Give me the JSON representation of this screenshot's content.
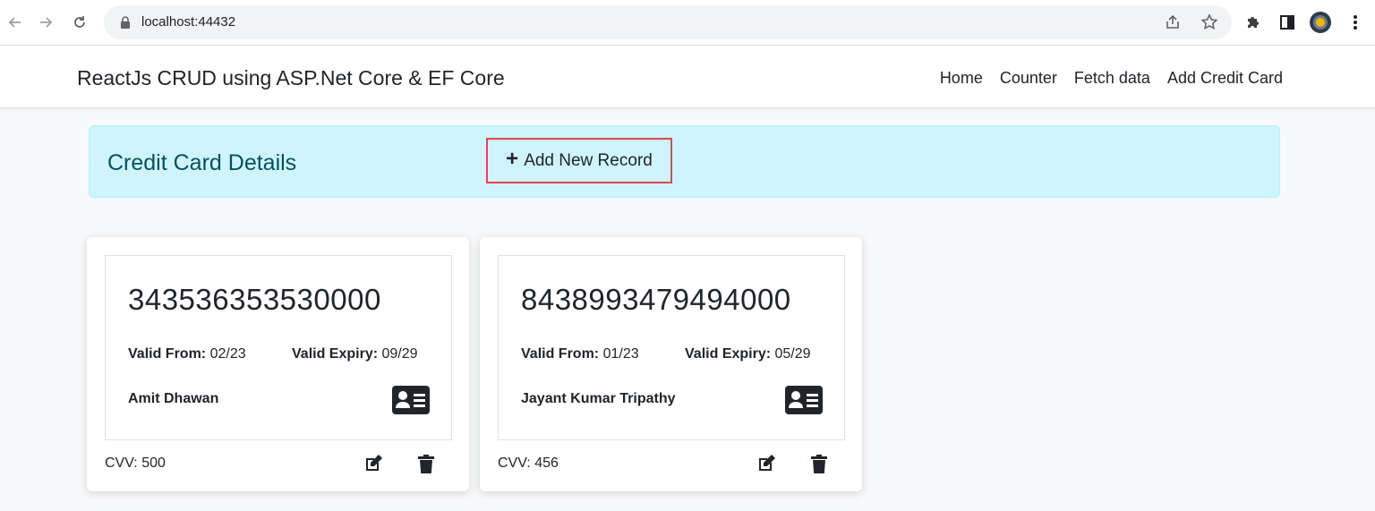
{
  "browser": {
    "url": "localhost:44432"
  },
  "navbar": {
    "brand": "ReactJs CRUD using ASP.Net Core & EF Core",
    "links": [
      {
        "label": "Home"
      },
      {
        "label": "Counter"
      },
      {
        "label": "Fetch data"
      },
      {
        "label": "Add Credit Card"
      }
    ]
  },
  "header": {
    "title": "Credit Card Details",
    "add_button_label": "Add New Record",
    "highlight_color": "#e0474c"
  },
  "cards": [
    {
      "number": "343536353530000",
      "valid_from_label": "Valid From:",
      "valid_from": "02/23",
      "valid_expiry_label": "Valid Expiry:",
      "valid_expiry": "09/29",
      "holder": "Amit Dhawan",
      "cvv": "CVV: 500"
    },
    {
      "number": "8438993479494000",
      "valid_from_label": "Valid From:",
      "valid_from": "01/23",
      "valid_expiry_label": "Valid Expiry:",
      "valid_expiry": "05/29",
      "holder": "Jayant Kumar Tripathy",
      "cvv": "CVV: 456"
    }
  ],
  "colors": {
    "alert_bg": "#cff4fc",
    "alert_text": "#055160",
    "page_bg": "#f8f9fa"
  }
}
